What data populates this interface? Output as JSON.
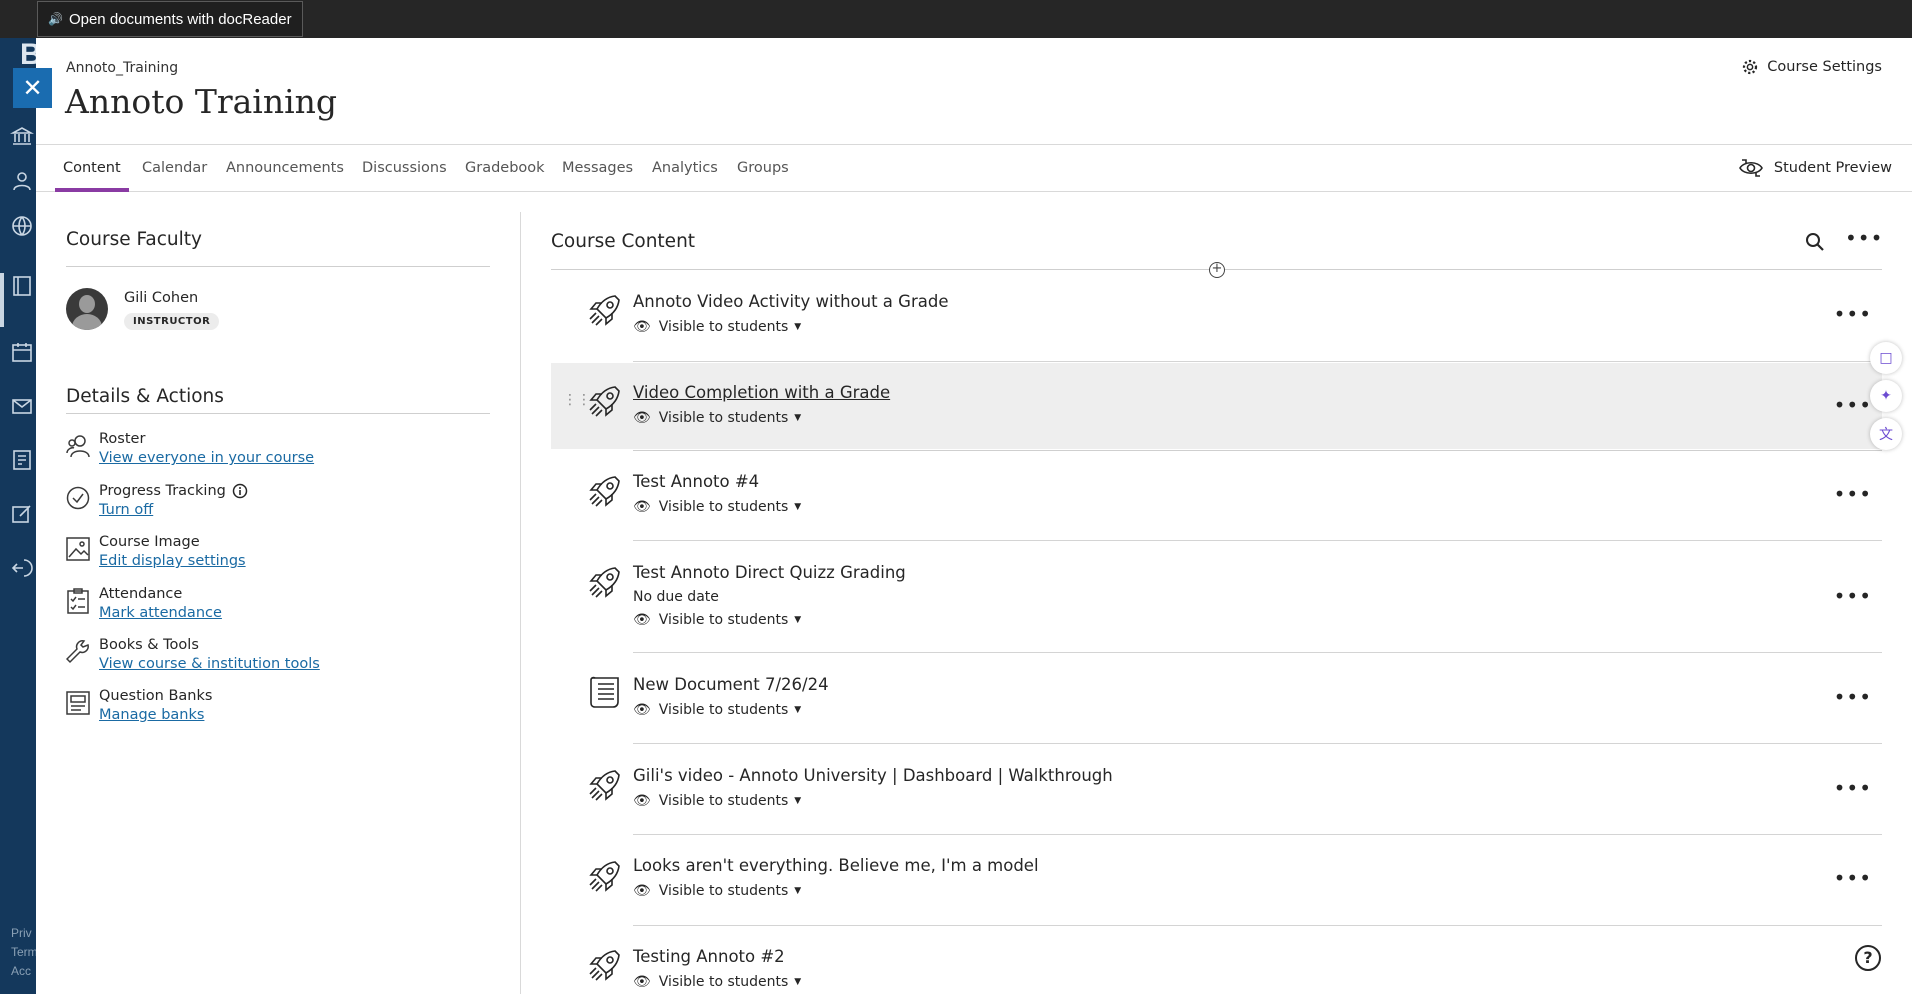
{
  "browser_bar": {
    "docreader_label": "Open documents with docReader"
  },
  "left_rail": {
    "brand_letter": "B",
    "footer": [
      "Priv",
      "Term",
      "Acc"
    ]
  },
  "header": {
    "breadcrumb": "Annoto_Training",
    "title": "Annoto Training",
    "course_settings": "Course Settings"
  },
  "tabs": [
    {
      "label": "Content",
      "active": true
    },
    {
      "label": "Calendar"
    },
    {
      "label": "Announcements"
    },
    {
      "label": "Discussions"
    },
    {
      "label": "Gradebook"
    },
    {
      "label": "Messages"
    },
    {
      "label": "Analytics"
    },
    {
      "label": "Groups"
    }
  ],
  "student_preview": "Student Preview",
  "faculty": {
    "heading": "Course Faculty",
    "name": "Gili Cohen",
    "role": "INSTRUCTOR"
  },
  "details": {
    "heading": "Details & Actions",
    "actions": [
      {
        "icon": "roster-icon",
        "label": "Roster",
        "link": "View everyone in your course"
      },
      {
        "icon": "progress-check-icon",
        "label": "Progress Tracking",
        "link": "Turn off"
      },
      {
        "icon": "image-icon",
        "label": "Course Image",
        "link": "Edit display settings"
      },
      {
        "icon": "attendance-icon",
        "label": "Attendance",
        "link": "Mark attendance"
      },
      {
        "icon": "wrench-icon",
        "label": "Books & Tools",
        "link": "View course & institution tools"
      },
      {
        "icon": "question-bank-icon",
        "label": "Question Banks",
        "link": "Manage banks"
      }
    ]
  },
  "course_content": {
    "heading": "Course Content",
    "items": [
      {
        "icon": "rocket-icon",
        "title": "Annoto Video Activity without a Grade",
        "visibility": "Visible to students"
      },
      {
        "icon": "rocket-icon",
        "title": "Video Completion with a Grade",
        "visibility": "Visible to students",
        "hovered": true
      },
      {
        "icon": "rocket-icon",
        "title": "Test Annoto #4",
        "visibility": "Visible to students"
      },
      {
        "icon": "rocket-icon",
        "title": "Test Annoto Direct Quizz Grading",
        "subtitle": "No due date",
        "visibility": "Visible to students"
      },
      {
        "icon": "document-icon",
        "title": "New Document 7/26/24",
        "visibility": "Visible to students"
      },
      {
        "icon": "rocket-icon",
        "title": "Gili's video - Annoto University | Dashboard | Walkthrough",
        "visibility": "Visible to students"
      },
      {
        "icon": "rocket-icon",
        "title": "Looks aren't everything. Believe me, I'm a model",
        "visibility": "Visible to students"
      },
      {
        "icon": "rocket-icon",
        "title": "Testing Annoto #2",
        "visibility": "Visible to students"
      }
    ]
  },
  "colors": {
    "accent_tab": "#8a3ba3",
    "link": "#1a6aa3",
    "rail": "#14385c",
    "close_button": "#1a6cb0"
  }
}
